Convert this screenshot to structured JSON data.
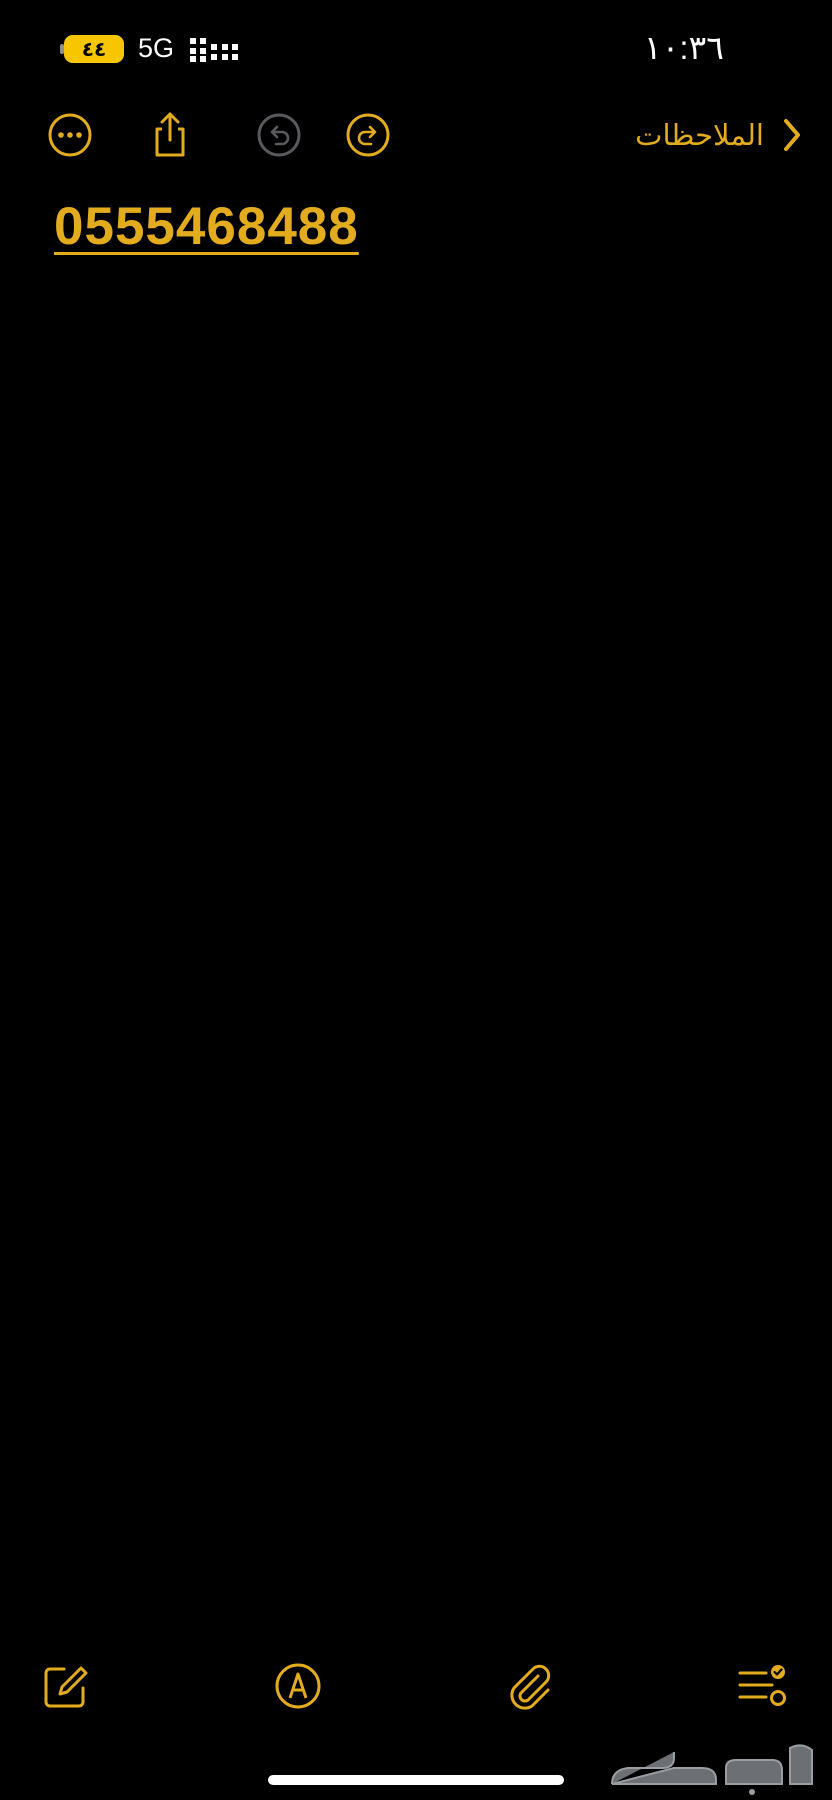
{
  "status_bar": {
    "battery_label": "٤٤",
    "battery_level": 1.0,
    "network": "5G",
    "time": "١٠:٣٦"
  },
  "toolbar": {
    "back_label": "الملاحظات",
    "icons": [
      "more-icon",
      "share-icon",
      "undo-icon",
      "redo-icon",
      "chevron-left-icon"
    ]
  },
  "note": {
    "text": "0555468488"
  },
  "bottom_bar": {
    "icons": [
      "compose-icon",
      "markup-icon",
      "attachment-icon",
      "checklist-icon"
    ]
  },
  "watermark": {
    "text": "حراج"
  },
  "colors": {
    "accent": "#e3ac1e",
    "background": "#000000",
    "disabled": "#5a5a5e"
  }
}
